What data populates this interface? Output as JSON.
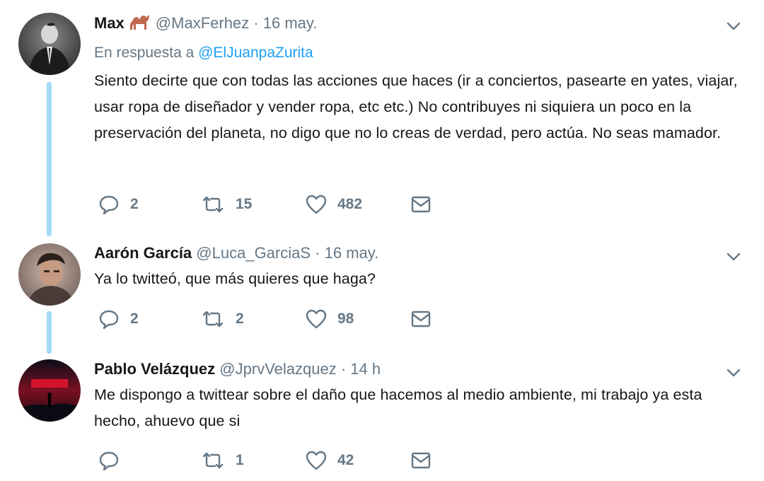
{
  "tweets": [
    {
      "name": "Max",
      "emoji": "camel-emoji",
      "handle": "@MaxFerhez",
      "time": "16 may.",
      "reply_prefix": "En respuesta a",
      "reply_handle": "@ElJuanpaZurita",
      "text": "Siento decirte que con todas las acciones que haces (ir a conciertos, pasearte en yates, viajar, usar ropa de diseñador y vender ropa, etc etc.) No contribuyes ni siquiera un poco en la preservación del planeta, no digo que no lo creas de verdad, pero actúa. No seas mamador.",
      "replies": "2",
      "retweets": "15",
      "likes": "482"
    },
    {
      "name": "Aarón García",
      "handle": "@Luca_GarciaS",
      "time": "16 may.",
      "text": "Ya lo twitteó, que más quieres que haga?",
      "replies": "2",
      "retweets": "2",
      "likes": "98"
    },
    {
      "name": "Pablo Velázquez",
      "handle": "@JprvVelazquez",
      "time": "14 h",
      "text": "Me dispongo a twittear sobre el daño que hacemos al medio ambiente, mi trabajo ya esta hecho, ahuevo que si",
      "replies": "",
      "retweets": "1",
      "likes": "42"
    }
  ],
  "separator": "·",
  "colors": {
    "accent": "#1da1f2",
    "thread_line": "#a4d9f5",
    "muted": "#657786",
    "text": "#14171a"
  }
}
